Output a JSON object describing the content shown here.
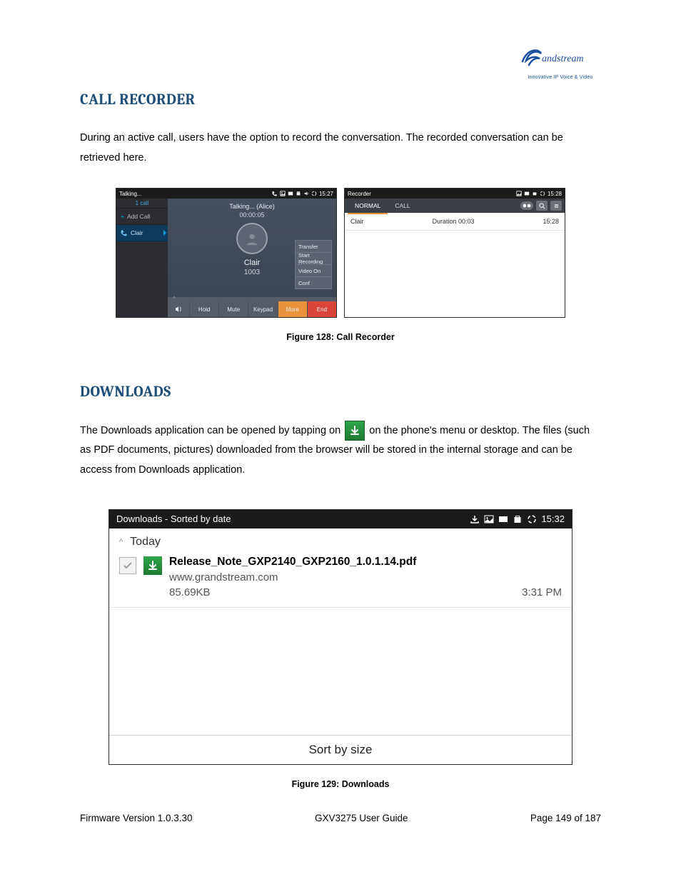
{
  "logo": {
    "brand": "Grandstream",
    "tagline": "Innovative IP Voice & Video"
  },
  "section1": {
    "heading": "CALL RECORDER",
    "paragraph": "During an active call, users have the option to record the conversation. The recorded conversation can be retrieved here."
  },
  "shot1": {
    "left": {
      "statusTitle": "Talking...",
      "statusTime": "15:27",
      "oneCall": "1 call",
      "addCall": "Add Call",
      "activeContact": "Clair",
      "talkingLine": "Talking... (Alice)",
      "duration": "00:00:05",
      "callerName": "Clair",
      "callerExt": "1003",
      "popup": [
        "Transfer",
        "Start Recording",
        "Video On",
        "Conf"
      ],
      "bottom": {
        "hold": "Hold",
        "mute": "Mute",
        "keypad": "Keypad",
        "more": "More",
        "end": "End"
      },
      "chevron": "^"
    },
    "right": {
      "statusTitle": "Recorder",
      "statusTime": "15:28",
      "tabNormal": "NORMAL",
      "tabCall": "CALL",
      "pill": "OO",
      "row": {
        "name": "Clair",
        "dur": "Duration 00:03",
        "time": "15:28"
      }
    },
    "caption": "Figure 128: Call Recorder"
  },
  "section2": {
    "heading": "DOWNLOADS",
    "pA": "The Downloads application can be opened by tapping on ",
    "pB": " on the phone's menu or desktop. The files (such as PDF documents, pictures) downloaded from the browser will be stored in the internal storage and can be access from Downloads application."
  },
  "shot2": {
    "statusTitle": "Downloads - Sorted by date",
    "statusTime": "15:32",
    "todayCaret": "^",
    "today": "Today",
    "file": {
      "name": "Release_Note_GXP2140_GXP2160_1.0.1.14.pdf",
      "src": "www.grandstream.com",
      "size": "85.69KB",
      "time": "3:31 PM"
    },
    "sort": "Sort by size",
    "caption": "Figure 129: Downloads"
  },
  "footer": {
    "left": "Firmware Version 1.0.3.30",
    "center": "GXV3275 User Guide",
    "right": "Page 149 of 187"
  }
}
